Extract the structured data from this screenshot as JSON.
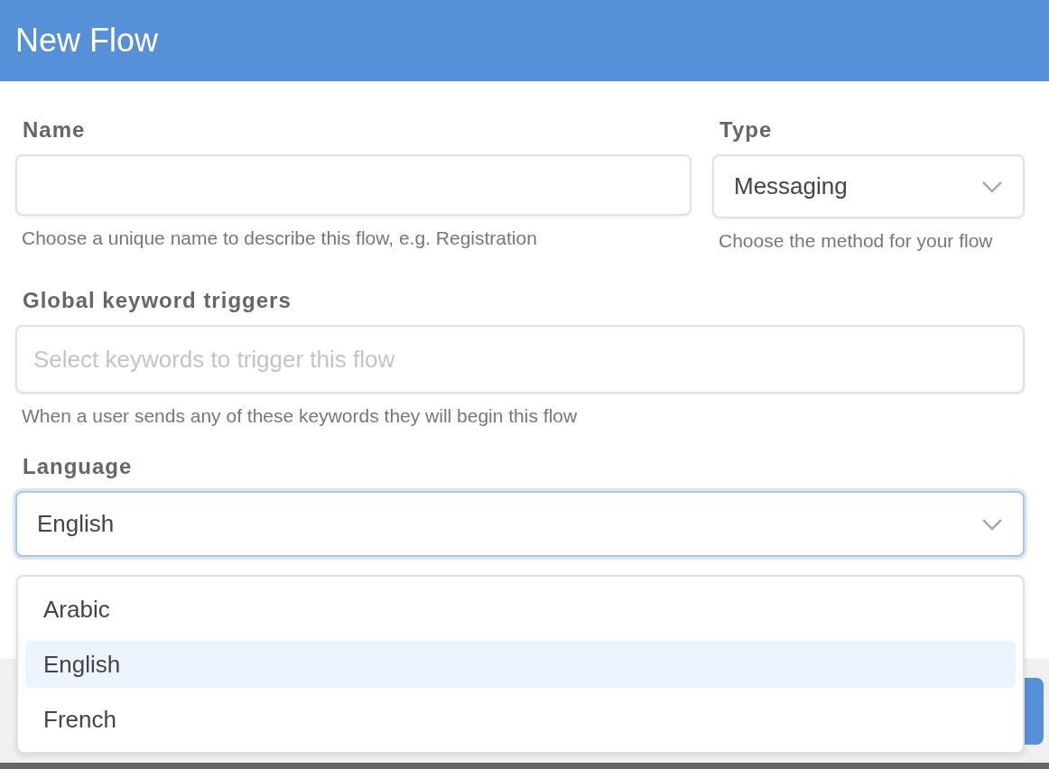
{
  "header": {
    "title": "New Flow"
  },
  "fields": [
    {
      "kind": "text",
      "label": "Name",
      "help": "Choose a unique name to describe this flow, e.g. Registration"
    },
    {
      "kind": "select",
      "label": "Type",
      "value": "Messaging",
      "help": "Choose the method for your flow"
    }
  ],
  "keywords": {
    "label": "Global keyword triggers",
    "placeholder": "Select keywords to trigger this flow",
    "help": "When a user sends any of these keywords they will begin this flow"
  },
  "language": {
    "label": "Language",
    "value": "English",
    "focused": true,
    "expanded": true,
    "options": [
      {
        "label": "Arabic",
        "selected": false
      },
      {
        "label": "English",
        "selected": true
      },
      {
        "label": "French",
        "selected": false
      }
    ]
  }
}
